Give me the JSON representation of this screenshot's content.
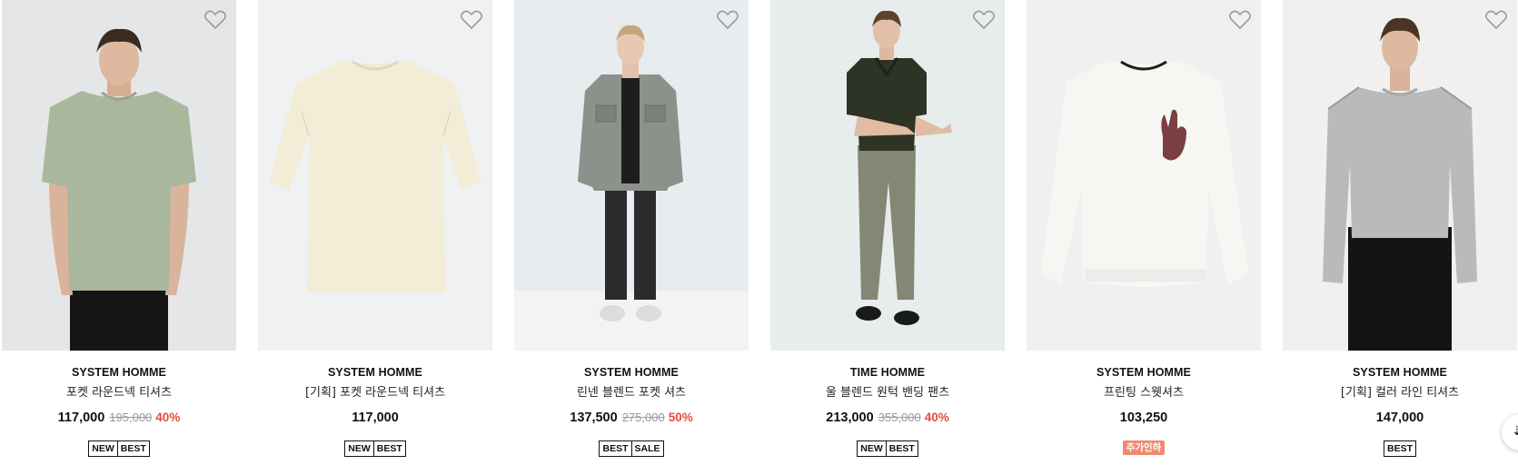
{
  "products": [
    {
      "brand": "SYSTEM HOMME",
      "name": "포켓 라운드넥 티셔츠",
      "price": "117,000",
      "original_price": "195,000",
      "discount": "40%",
      "badges": [
        "NEW",
        "BEST"
      ],
      "bg": "#e6e8ea",
      "garment": "tee-model",
      "color": "#a9b79d"
    },
    {
      "brand": "SYSTEM HOMME",
      "name": "[기획] 포켓 라운드넥 티셔츠",
      "price": "117,000",
      "original_price": "",
      "discount": "",
      "badges": [
        "NEW",
        "BEST"
      ],
      "bg": "#eff1f3",
      "garment": "tee-flat",
      "color": "#f3ecd6"
    },
    {
      "brand": "SYSTEM HOMME",
      "name": "린넨 블렌드 포켓 셔츠",
      "price": "137,500",
      "original_price": "275,000",
      "discount": "50%",
      "badges": [
        "BEST",
        "SALE"
      ],
      "bg": "#e9ecef",
      "garment": "shirt-model",
      "color": "#8d918c"
    },
    {
      "brand": "TIME HOMME",
      "name": "울 블렌드 원턱 밴딩 팬츠",
      "price": "213,000",
      "original_price": "355,000",
      "discount": "40%",
      "badges": [
        "NEW",
        "BEST"
      ],
      "bg": "#e7ecec",
      "garment": "pants-model",
      "color": "#858674"
    },
    {
      "brand": "SYSTEM HOMME",
      "name": "프린팅 스웻셔츠",
      "price": "103,250",
      "original_price": "",
      "discount": "",
      "badges": [
        "추가인하"
      ],
      "bg": "#eef0f2",
      "garment": "sweat-flat",
      "color": "#f4f4f1"
    },
    {
      "brand": "SYSTEM HOMME",
      "name": "[기획] 컬러 라인 티셔츠",
      "price": "147,000",
      "original_price": "",
      "discount": "",
      "badges": [
        "BEST"
      ],
      "bg": "#f1f0ee",
      "garment": "sweat-model",
      "color": "#b8babc"
    }
  ],
  "icons": {
    "wishlist": "heart-outline-icon",
    "scroll": "scroll-down-icon"
  },
  "colors": {
    "discount": "#e74c3c",
    "pink_badge": "#ef8a72"
  }
}
